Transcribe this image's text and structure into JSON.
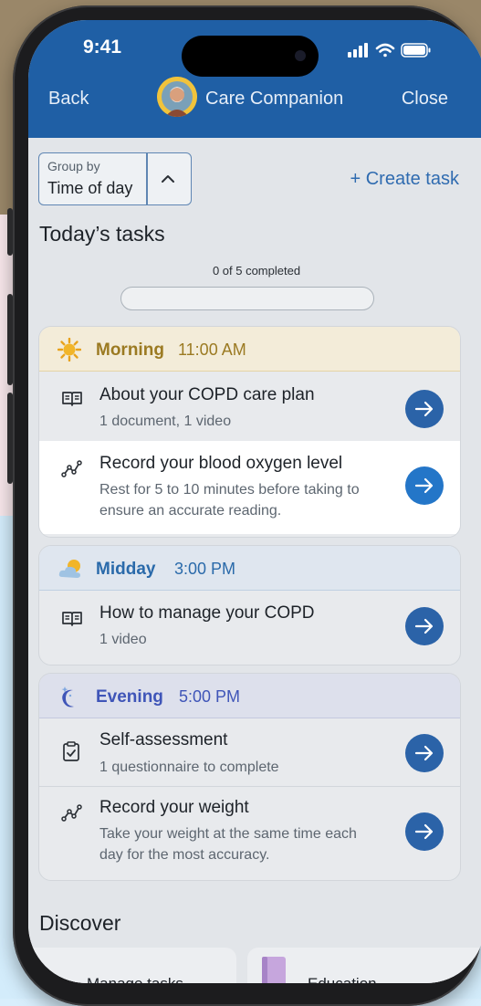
{
  "status": {
    "time": "9:41"
  },
  "nav": {
    "back": "Back",
    "title": "Care Companion",
    "close": "Close"
  },
  "group_by": {
    "label": "Group by",
    "value": "Time of day"
  },
  "create_task": "+ Create task",
  "today_title": "Today’s tasks",
  "progress": {
    "text": "0 of 5 completed",
    "fraction": 0
  },
  "sections": [
    {
      "name": "Morning",
      "time": "11:00 AM",
      "icon": "sun-icon",
      "header_bg": "#f3ecd9",
      "name_color": "#9b7a22",
      "tasks": [
        {
          "icon": "book-icon",
          "title": "About your COPD care plan",
          "subtitle": "1 document, 1 video"
        },
        {
          "icon": "chart-line-icon",
          "title": "Record your blood oxygen level",
          "subtitle": "Rest for 5 to 10 minutes before taking to ensure an accurate reading."
        }
      ]
    },
    {
      "name": "Midday",
      "time": "3:00 PM",
      "icon": "partly-cloudy-icon",
      "header_bg": "#dfe6ef",
      "name_color": "#2a6aaa",
      "tasks": [
        {
          "icon": "book-icon",
          "title": "How to manage your COPD",
          "subtitle": "1 video"
        }
      ]
    },
    {
      "name": "Evening",
      "time": "5:00 PM",
      "icon": "moon-icon",
      "header_bg": "#dde0ec",
      "name_color": "#3f55b8",
      "tasks": [
        {
          "icon": "clipboard-check-icon",
          "title": "Self-assessment",
          "subtitle": "1 questionnaire to complete"
        },
        {
          "icon": "chart-line-icon",
          "title": "Record your weight",
          "subtitle": "Take your weight at the same time each day for the most accuracy."
        }
      ]
    }
  ],
  "discover": {
    "title": "Discover",
    "cards": [
      "Manage tasks",
      "Education"
    ]
  },
  "colors": {
    "header": "#1f5fa5",
    "accent": "#2f6bb0",
    "button": "#2b63a8"
  }
}
